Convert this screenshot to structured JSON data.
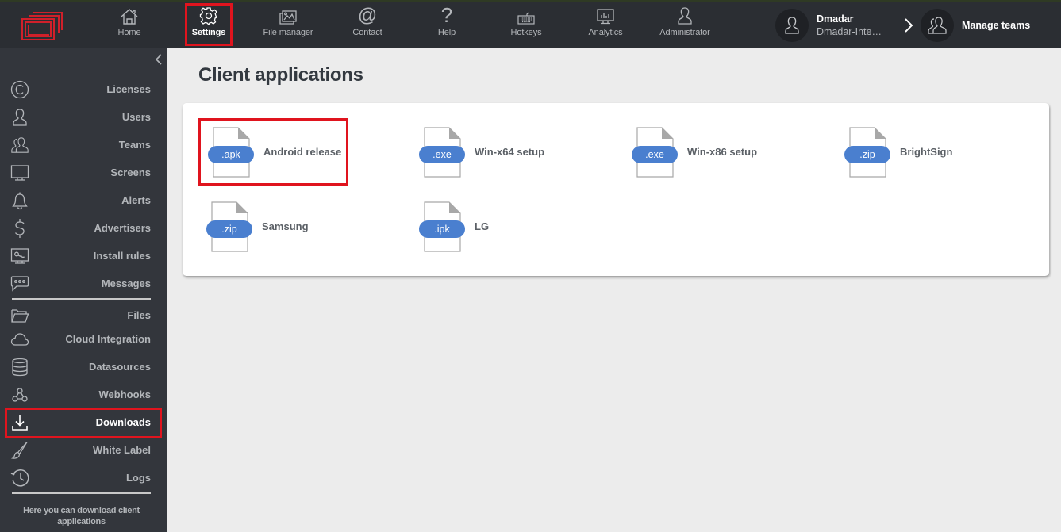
{
  "topnav": {
    "items": [
      {
        "label": "Home",
        "icon": "home-icon"
      },
      {
        "label": "Settings",
        "icon": "gear-icon",
        "active": true
      },
      {
        "label": "File manager",
        "icon": "images-icon"
      },
      {
        "label": "Contact",
        "icon": "at-icon"
      },
      {
        "label": "Help",
        "icon": "question-icon"
      },
      {
        "label": "Hotkeys",
        "icon": "keyboard-icon"
      },
      {
        "label": "Analytics",
        "icon": "analytics-monitor-icon"
      },
      {
        "label": "Administrator",
        "icon": "user-icon"
      }
    ],
    "user": {
      "name": "Dmadar",
      "team": "Dmadar-Inte…"
    },
    "manage_teams_label": "Manage teams"
  },
  "sidebar": {
    "items": [
      {
        "label": "Licenses",
        "icon": "copyright-icon"
      },
      {
        "label": "Users",
        "icon": "user-icon"
      },
      {
        "label": "Teams",
        "icon": "users-icon"
      },
      {
        "label": "Screens",
        "icon": "monitor-icon"
      },
      {
        "label": "Alerts",
        "icon": "bell-icon"
      },
      {
        "label": "Advertisers",
        "icon": "dollar-icon"
      },
      {
        "label": "Install rules",
        "icon": "monitor-key-icon"
      },
      {
        "label": "Messages",
        "icon": "message-icon"
      },
      {
        "label": "Files",
        "icon": "folder-icon"
      },
      {
        "label": "Cloud Integration",
        "icon": "cloud-icon"
      },
      {
        "label": "Datasources",
        "icon": "database-icon"
      },
      {
        "label": "Webhooks",
        "icon": "webhook-icon"
      },
      {
        "label": "Downloads",
        "icon": "download-icon",
        "active": true
      },
      {
        "label": "White Label",
        "icon": "brush-icon"
      },
      {
        "label": "Logs",
        "icon": "history-icon"
      }
    ],
    "help_text": "Here you can download client applications"
  },
  "main": {
    "title": "Client applications",
    "apps": [
      {
        "ext": ".apk",
        "name": "Android release"
      },
      {
        "ext": ".exe",
        "name": "Win-x64 setup"
      },
      {
        "ext": ".exe",
        "name": "Win-x86 setup"
      },
      {
        "ext": ".zip",
        "name": "BrightSign"
      },
      {
        "ext": ".zip",
        "name": "Samsung"
      },
      {
        "ext": ".ipk",
        "name": "LG"
      }
    ]
  },
  "colors": {
    "accent_red": "#e0141e",
    "badge_blue": "#4a7fcf",
    "topbar_bg": "#2b2e33",
    "sidebar_bg": "#33363c"
  }
}
